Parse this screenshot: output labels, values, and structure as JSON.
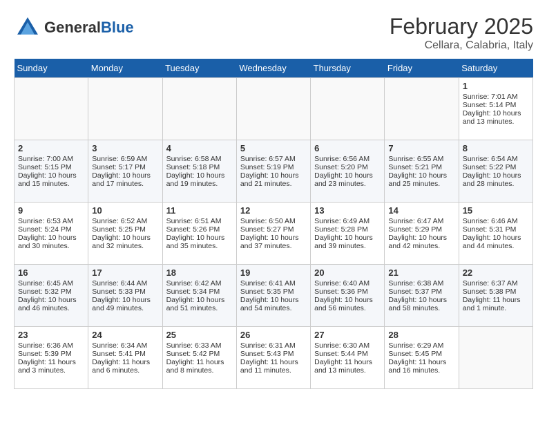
{
  "header": {
    "logo_general": "General",
    "logo_blue": "Blue",
    "month": "February 2025",
    "location": "Cellara, Calabria, Italy"
  },
  "weekdays": [
    "Sunday",
    "Monday",
    "Tuesday",
    "Wednesday",
    "Thursday",
    "Friday",
    "Saturday"
  ],
  "weeks": [
    [
      {
        "day": "",
        "info": ""
      },
      {
        "day": "",
        "info": ""
      },
      {
        "day": "",
        "info": ""
      },
      {
        "day": "",
        "info": ""
      },
      {
        "day": "",
        "info": ""
      },
      {
        "day": "",
        "info": ""
      },
      {
        "day": "1",
        "info": "Sunrise: 7:01 AM\nSunset: 5:14 PM\nDaylight: 10 hours\nand 13 minutes."
      }
    ],
    [
      {
        "day": "2",
        "info": "Sunrise: 7:00 AM\nSunset: 5:15 PM\nDaylight: 10 hours\nand 15 minutes."
      },
      {
        "day": "3",
        "info": "Sunrise: 6:59 AM\nSunset: 5:17 PM\nDaylight: 10 hours\nand 17 minutes."
      },
      {
        "day": "4",
        "info": "Sunrise: 6:58 AM\nSunset: 5:18 PM\nDaylight: 10 hours\nand 19 minutes."
      },
      {
        "day": "5",
        "info": "Sunrise: 6:57 AM\nSunset: 5:19 PM\nDaylight: 10 hours\nand 21 minutes."
      },
      {
        "day": "6",
        "info": "Sunrise: 6:56 AM\nSunset: 5:20 PM\nDaylight: 10 hours\nand 23 minutes."
      },
      {
        "day": "7",
        "info": "Sunrise: 6:55 AM\nSunset: 5:21 PM\nDaylight: 10 hours\nand 25 minutes."
      },
      {
        "day": "8",
        "info": "Sunrise: 6:54 AM\nSunset: 5:22 PM\nDaylight: 10 hours\nand 28 minutes."
      }
    ],
    [
      {
        "day": "9",
        "info": "Sunrise: 6:53 AM\nSunset: 5:24 PM\nDaylight: 10 hours\nand 30 minutes."
      },
      {
        "day": "10",
        "info": "Sunrise: 6:52 AM\nSunset: 5:25 PM\nDaylight: 10 hours\nand 32 minutes."
      },
      {
        "day": "11",
        "info": "Sunrise: 6:51 AM\nSunset: 5:26 PM\nDaylight: 10 hours\nand 35 minutes."
      },
      {
        "day": "12",
        "info": "Sunrise: 6:50 AM\nSunset: 5:27 PM\nDaylight: 10 hours\nand 37 minutes."
      },
      {
        "day": "13",
        "info": "Sunrise: 6:49 AM\nSunset: 5:28 PM\nDaylight: 10 hours\nand 39 minutes."
      },
      {
        "day": "14",
        "info": "Sunrise: 6:47 AM\nSunset: 5:29 PM\nDaylight: 10 hours\nand 42 minutes."
      },
      {
        "day": "15",
        "info": "Sunrise: 6:46 AM\nSunset: 5:31 PM\nDaylight: 10 hours\nand 44 minutes."
      }
    ],
    [
      {
        "day": "16",
        "info": "Sunrise: 6:45 AM\nSunset: 5:32 PM\nDaylight: 10 hours\nand 46 minutes."
      },
      {
        "day": "17",
        "info": "Sunrise: 6:44 AM\nSunset: 5:33 PM\nDaylight: 10 hours\nand 49 minutes."
      },
      {
        "day": "18",
        "info": "Sunrise: 6:42 AM\nSunset: 5:34 PM\nDaylight: 10 hours\nand 51 minutes."
      },
      {
        "day": "19",
        "info": "Sunrise: 6:41 AM\nSunset: 5:35 PM\nDaylight: 10 hours\nand 54 minutes."
      },
      {
        "day": "20",
        "info": "Sunrise: 6:40 AM\nSunset: 5:36 PM\nDaylight: 10 hours\nand 56 minutes."
      },
      {
        "day": "21",
        "info": "Sunrise: 6:38 AM\nSunset: 5:37 PM\nDaylight: 10 hours\nand 58 minutes."
      },
      {
        "day": "22",
        "info": "Sunrise: 6:37 AM\nSunset: 5:38 PM\nDaylight: 11 hours\nand 1 minute."
      }
    ],
    [
      {
        "day": "23",
        "info": "Sunrise: 6:36 AM\nSunset: 5:39 PM\nDaylight: 11 hours\nand 3 minutes."
      },
      {
        "day": "24",
        "info": "Sunrise: 6:34 AM\nSunset: 5:41 PM\nDaylight: 11 hours\nand 6 minutes."
      },
      {
        "day": "25",
        "info": "Sunrise: 6:33 AM\nSunset: 5:42 PM\nDaylight: 11 hours\nand 8 minutes."
      },
      {
        "day": "26",
        "info": "Sunrise: 6:31 AM\nSunset: 5:43 PM\nDaylight: 11 hours\nand 11 minutes."
      },
      {
        "day": "27",
        "info": "Sunrise: 6:30 AM\nSunset: 5:44 PM\nDaylight: 11 hours\nand 13 minutes."
      },
      {
        "day": "28",
        "info": "Sunrise: 6:29 AM\nSunset: 5:45 PM\nDaylight: 11 hours\nand 16 minutes."
      },
      {
        "day": "",
        "info": ""
      }
    ]
  ]
}
